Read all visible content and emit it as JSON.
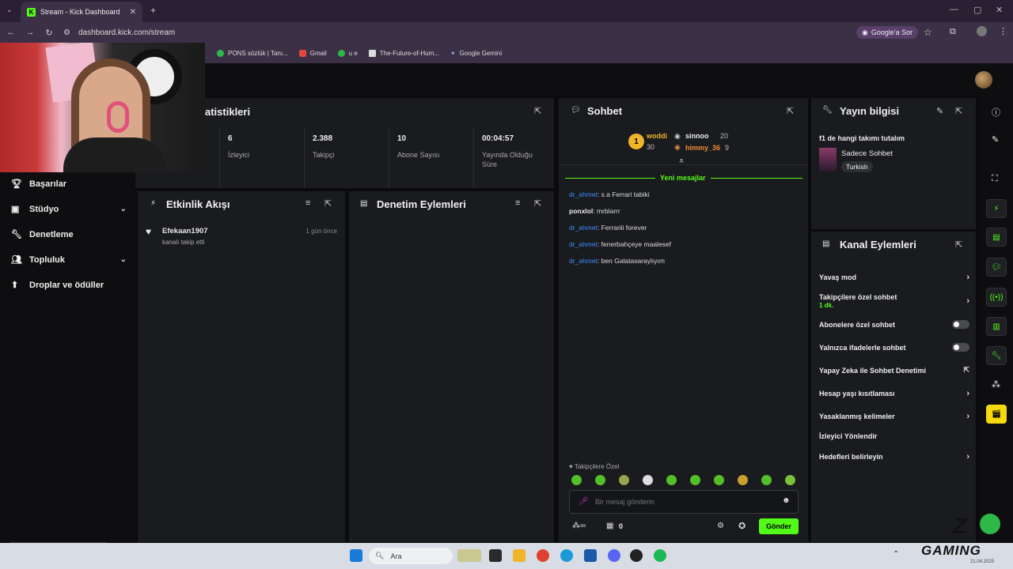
{
  "browser": {
    "tab_title": "Stream - Kick Dashboard",
    "tab_favicon": "K",
    "url": "dashboard.kick.com/stream",
    "ask_button": "Google'a Sor",
    "bookmarks": [
      "PONS sözlük | Tanı...",
      "Gmail",
      "u e",
      "The-Future-of-Hum...",
      "Google Gemini"
    ]
  },
  "sidebar": {
    "items": [
      {
        "label": "Başarılar",
        "icon": "trophy-icon"
      },
      {
        "label": "Stüdyo",
        "icon": "studio-icon"
      },
      {
        "label": "Denetleme",
        "icon": "wrench-icon"
      },
      {
        "label": "Topluluk",
        "icon": "people-icon"
      },
      {
        "label": "Droplar ve ödüller",
        "icon": "drops-icon"
      }
    ]
  },
  "stats": {
    "title": "atistikleri",
    "items": [
      {
        "value": "6",
        "label": "İzleyici"
      },
      {
        "value": "2.388",
        "label": "Takipçi"
      },
      {
        "value": "10",
        "label": "Abone Sayısı"
      },
      {
        "value": "00:04:57",
        "label": "Yayında Olduğu Süre"
      }
    ]
  },
  "activity": {
    "title": "Etkinlik Akışı",
    "events": [
      {
        "user": "Efekaan1907",
        "text": "kanalı takip etti",
        "time": "1 gün önce"
      }
    ]
  },
  "moderation": {
    "title": "Denetim Eylemleri"
  },
  "chat": {
    "title": "Sohbet",
    "leaderboard": [
      {
        "rank": "1",
        "name": "woddi",
        "score": "30"
      },
      {
        "name": "sinnoo",
        "score": "20"
      },
      {
        "name": "himmy_36",
        "score": "9"
      }
    ],
    "new_messages": "Yeni mesajlar",
    "messages": [
      {
        "user": "dr_ahmet",
        "text": ": s.a Ferrari tabiki"
      },
      {
        "user": "ponxlol",
        "text": ": mrblarrr"
      },
      {
        "user": "dr_ahmet",
        "text": ": Ferrariii forever"
      },
      {
        "user": "dr_ahmet",
        "text": ": fenerbahçeye maalesef"
      },
      {
        "user": "dr_ahmet",
        "text": ": ben Galatasaraylıyım"
      }
    ],
    "followers_only": "Takipçilere Özel",
    "input_placeholder": "Bir mesaj gönderin",
    "send_button": "Gönder",
    "points": "0"
  },
  "stream_info": {
    "title": "Yayın bilgisi",
    "stream_title": "f1 de hangi takımı tutalım",
    "category": "Sadece Sohbet",
    "language": "Turkish"
  },
  "channel_actions": {
    "title": "Kanal Eylemleri",
    "slow_mode": "Yavaş mod",
    "followers_chat": "Takipçilere özel sohbet",
    "followers_chat_sub": "1 dk.",
    "subscribers_chat": "Abonelere özel sohbet",
    "emotes_chat": "Yalnızca ifadelerle sohbet",
    "ai_moderation": "Yapay Zeka ile Sohbet Denetimi",
    "account_age": "Hesap yaşı kısıtlaması",
    "banned_words": "Yasaklanmış kelimeler",
    "redirect": "İzleyici Yönlendir",
    "goals": "Hedefleri belirleyin"
  },
  "taskbar": {
    "search": "Ara",
    "brand": "GAMING",
    "date": "21.04.2025"
  },
  "colors": {
    "accent": "#53fc18",
    "link": "#3d8bff",
    "panel": "#1a1b1e"
  }
}
